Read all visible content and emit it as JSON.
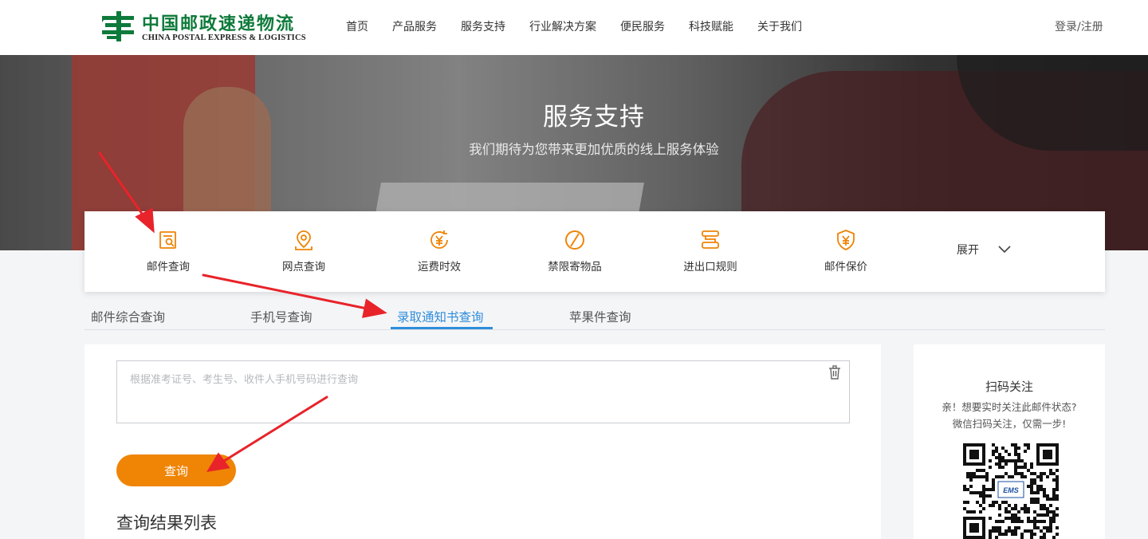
{
  "header": {
    "logo_cn": "中国邮政速递物流",
    "logo_en": "CHINA POSTAL EXPRESS & LOGISTICS",
    "nav": [
      "首页",
      "产品服务",
      "服务支持",
      "行业解决方案",
      "便民服务",
      "科技赋能",
      "关于我们"
    ],
    "login": "登录/注册"
  },
  "banner": {
    "title": "服务支持",
    "subtitle": "我们期待为您带来更加优质的线上服务体验"
  },
  "services": {
    "items": [
      {
        "label": "邮件查询",
        "icon": "mail-search-icon"
      },
      {
        "label": "网点查询",
        "icon": "location-pin-icon"
      },
      {
        "label": "运费时效",
        "icon": "yen-clock-icon"
      },
      {
        "label": "禁限寄物品",
        "icon": "prohibited-icon"
      },
      {
        "label": "进出口规则",
        "icon": "rules-icon"
      },
      {
        "label": "邮件保价",
        "icon": "yen-shield-icon"
      }
    ],
    "expand": "展开"
  },
  "tabs": {
    "items": [
      "邮件综合查询",
      "手机号查询",
      "录取通知书查询",
      "苹果件查询"
    ],
    "active": "录取通知书查询"
  },
  "query": {
    "placeholder": "根据准考证号、考生号、收件人手机号码进行查询",
    "value": "",
    "button": "查询",
    "results_title": "查询结果列表"
  },
  "side": {
    "title": "扫码关注",
    "desc_line1": "亲！想要实时关注此邮件状态?",
    "desc_line2": "微信扫码关注，仅需一步!",
    "qr_logo": "EMS"
  },
  "colors": {
    "brand_green": "#0e7a3b",
    "accent_orange": "#ef8405",
    "tab_active": "#2e8ddb",
    "annotation_red": "#e8232a"
  }
}
